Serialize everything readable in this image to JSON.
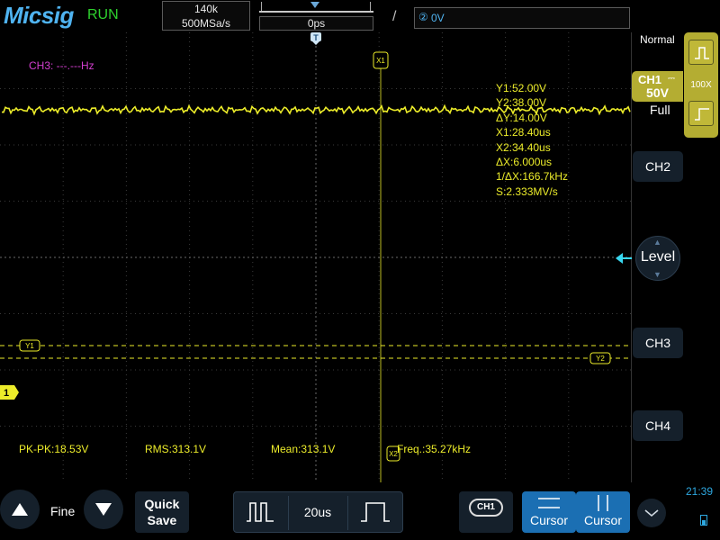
{
  "header": {
    "brand": "Micsig",
    "run_status": "RUN",
    "memory_depth": "140k",
    "sample_rate": "500MSa/s",
    "horizontal_position": "0ps",
    "trigger_level": "0V",
    "trigger_edge_icon": "rising-edge-icon"
  },
  "screen": {
    "ch3_frequency": "CH3: ---.---Hz",
    "trigger_marker": "T",
    "cursor_x1_tag": "X1",
    "cursor_x2_tag": "X2",
    "cursor_y1_tag": "Y1",
    "cursor_y2_tag": "Y2",
    "ch1_marker": "1",
    "cursor_readouts": [
      "Y1:52.00V",
      "Y2:38.00V",
      "ΔY:14.00V",
      "X1:28.40us",
      "X2:34.40us",
      "ΔX:6.000us",
      "1/ΔX:166.7kHz",
      "S:2.333MV/s"
    ],
    "measurements": {
      "pk_pk": "PK-PK:18.53V",
      "rms": "RMS:313.1V",
      "mean": "Mean:313.1V",
      "freq": "Freq.:35.27kHz"
    }
  },
  "right_panel": {
    "trigger_mode": "Normal",
    "ch1_label": "CH1",
    "ch1_coupling_icon": "dc-coupling-icon",
    "ch1_scale": "50V",
    "ch1_bandwidth": "Full",
    "probe_ratio": "100X",
    "ch2_label": "CH2",
    "ch3_label": "CH3",
    "ch4_label": "CH4",
    "level_label": "Level"
  },
  "bottom_bar": {
    "fine_label": "Fine",
    "quick_save_label": "Quick\nSave",
    "timebase": "20us",
    "channel_select_badge": "CH1",
    "cursor_h_label": "Cursor",
    "cursor_v_label": "Cursor",
    "clock": "21:39"
  },
  "colors": {
    "ch1": "#ecec2a",
    "ch3": "#d43fd0",
    "brand": "#4fb3f0",
    "run": "#2ed12e",
    "button_bg": "#15202b",
    "cursor_button": "#1b6fb3",
    "ch1_panel": "#b4ad32"
  }
}
